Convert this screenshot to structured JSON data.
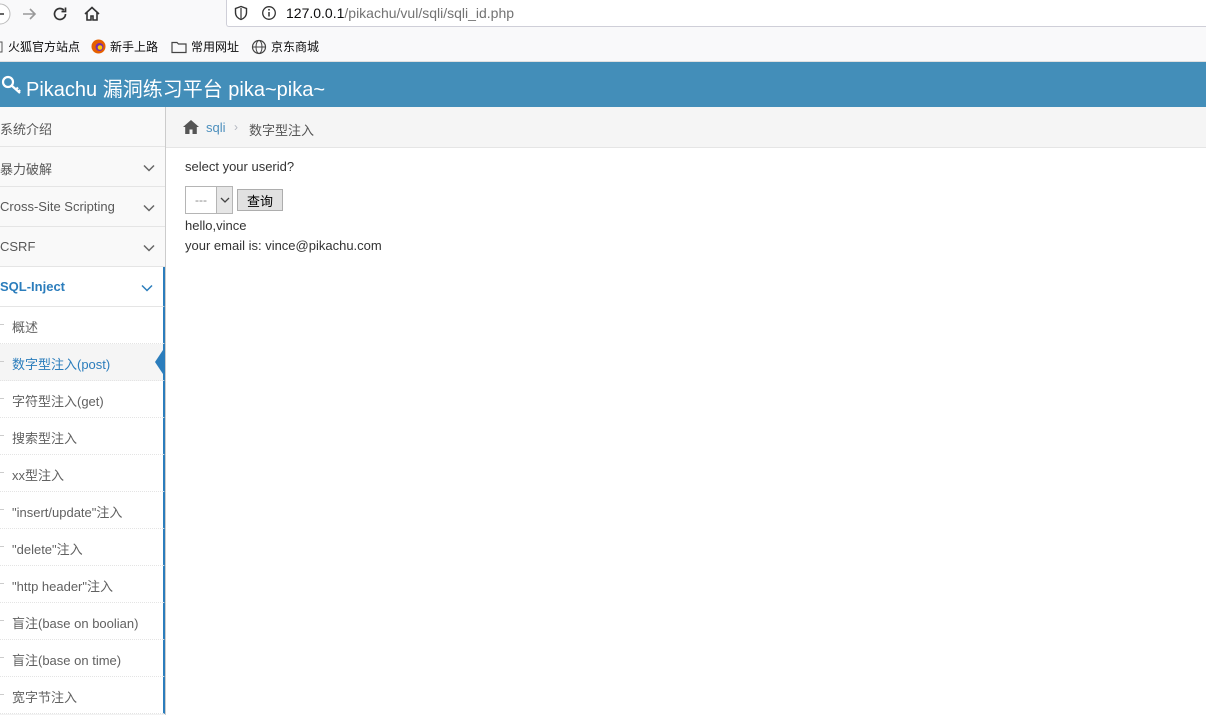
{
  "browser": {
    "url_host": "127.0.0.1",
    "url_path": "/pikachu/vul/sqli/sqli_id.php",
    "bookmarks": [
      "火狐官方站点",
      "新手上路",
      "常用网址",
      "京东商城"
    ]
  },
  "app": {
    "title": "Pikachu 漏洞练习平台 pika~pika~",
    "header_color": "#438eb9",
    "accent_color": "#2b7dbc"
  },
  "sidebar": {
    "menu": [
      {
        "label": "系统介绍"
      },
      {
        "label": "暴力破解"
      },
      {
        "label": "Cross-Site Scripting"
      },
      {
        "label": "CSRF"
      },
      {
        "label": "SQL-Inject"
      }
    ],
    "sub_items": [
      {
        "label": "概述"
      },
      {
        "label": "数字型注入(post)"
      },
      {
        "label": "字符型注入(get)"
      },
      {
        "label": "搜索型注入"
      },
      {
        "label": "xx型注入"
      },
      {
        "label": "\"insert/update\"注入"
      },
      {
        "label": "\"delete\"注入"
      },
      {
        "label": "\"http header\"注入"
      },
      {
        "label": "盲注(base on boolian)"
      },
      {
        "label": "盲注(base on time)"
      },
      {
        "label": "宽字节注入"
      }
    ]
  },
  "breadcrumb": {
    "parent": "sqli",
    "current": "数字型注入"
  },
  "form": {
    "prompt": "select your userid?",
    "select_value": "---",
    "submit_label": "查询"
  },
  "result": {
    "line1": "hello,vince",
    "line2": "your email is: vince@pikachu.com"
  }
}
